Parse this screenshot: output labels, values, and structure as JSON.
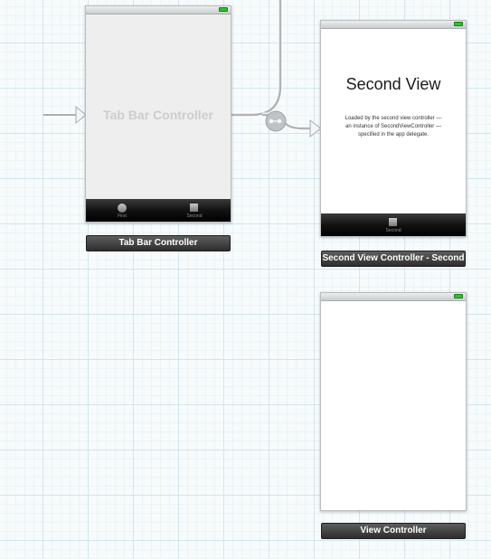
{
  "tab_bar_scene": {
    "placeholder_title": "Tab Bar Controller",
    "tabs": [
      {
        "label": "First",
        "icon": "circle-icon"
      },
      {
        "label": "Second",
        "icon": "square-icon"
      }
    ],
    "scene_label": "Tab Bar Controller"
  },
  "second_view_scene": {
    "heading": "Second View",
    "body_lines": [
      "Loaded by the second view controller —",
      "an instance of SecondViewController —",
      "specified in the app delegate."
    ],
    "tab_label": "Second",
    "scene_label": "Second View Controller - Second"
  },
  "view_controller_scene": {
    "scene_label": "View Controller"
  },
  "colors": {
    "canvas": "#f7fbfc",
    "grid_major": "#d2e6ec",
    "grid_minor": "#ebf4f7",
    "battery": "#2fbf2f",
    "label_bg": "#3a3a3a"
  }
}
